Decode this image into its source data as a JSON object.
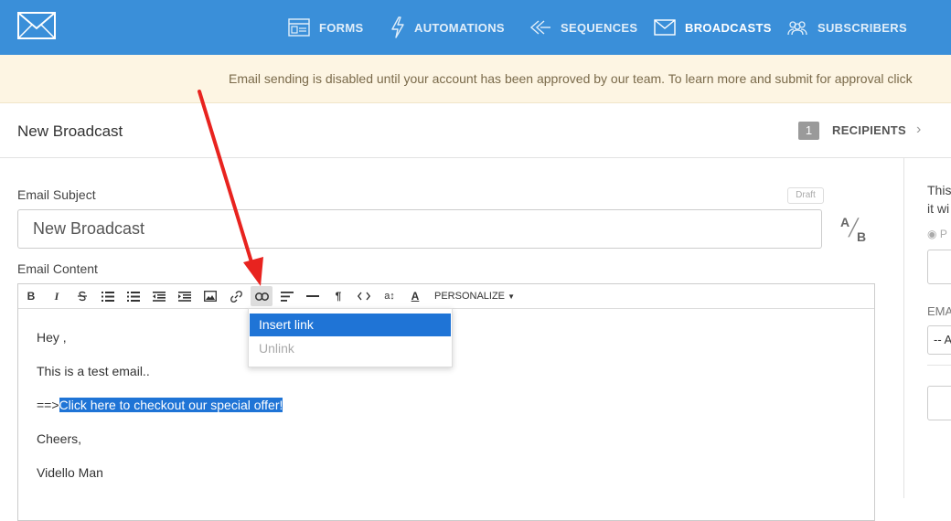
{
  "nav": {
    "items": [
      {
        "label": "FORMS",
        "icon": "forms-icon"
      },
      {
        "label": "AUTOMATIONS",
        "icon": "lightning-icon"
      },
      {
        "label": "SEQUENCES",
        "icon": "sequences-icon"
      },
      {
        "label": "BROADCASTS",
        "icon": "envelope-icon",
        "active": true
      },
      {
        "label": "SUBSCRIBERS",
        "icon": "people-icon"
      }
    ]
  },
  "banner": {
    "text": "Email sending is disabled until your account has been approved by our team. To learn more and submit for approval click"
  },
  "header": {
    "title": "New Broadcast",
    "step_number": "1",
    "step_label": "RECIPIENTS",
    "step_chevron": "›"
  },
  "form": {
    "subject_label": "Email Subject",
    "draft_badge": "Draft",
    "subject_value": "New Broadcast",
    "ab_a": "A",
    "ab_b": "B",
    "content_label": "Email Content"
  },
  "toolbar": {
    "bold": "B",
    "italic": "I",
    "personalize": "PERSONALIZE"
  },
  "content": {
    "line1": "Hey ,",
    "line2": "This is a test email..",
    "line3_prefix": "==>",
    "line3_link": "Click here to checkout our special offer!",
    "line4": "Cheers,",
    "line5": "Vidello Man"
  },
  "dropdown": {
    "insert_link": "Insert link",
    "unlink": "Unlink"
  },
  "right_panel": {
    "line1": "This",
    "line2": "it wi",
    "preview_label": "P",
    "email_label": "EMA",
    "select_value": "-- A"
  },
  "colors": {
    "nav_bg": "#3a8fd9",
    "banner_bg": "#fdf5e3",
    "selection": "#1f74d6",
    "arrow": "#e8231f"
  }
}
